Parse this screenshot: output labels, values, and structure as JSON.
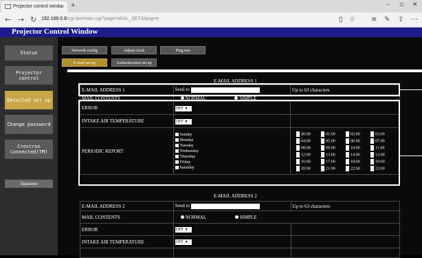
{
  "browser": {
    "tab_title": "Projector control windo",
    "tab_close": "×",
    "new_tab": "+",
    "url_host": "192.168.0.8",
    "url_path": "/cgi-bin/main.cgi?page=MAIL_SET&lang=e",
    "back": "←",
    "forward": "→",
    "refresh": "↻",
    "min": "–",
    "max": "▫",
    "close": "✕"
  },
  "page": {
    "title": "Projector Control Window"
  },
  "sidebar": {
    "items": [
      {
        "label": "Status"
      },
      {
        "label": "Projector control"
      },
      {
        "label": "Detailed set up"
      },
      {
        "label": "Change password"
      },
      {
        "label": "Crestron Connected(TM)"
      }
    ],
    "language": "Japanese"
  },
  "tabs": [
    {
      "label": "Network config"
    },
    {
      "label": "Adjust clock"
    },
    {
      "label": "Ping test"
    },
    {
      "label": "E-mail set up"
    },
    {
      "label": "Authentication set up"
    }
  ],
  "email1": {
    "header": "E-MAIL ADDRESS 1",
    "address_label": "E-MAIL ADDRESS 1",
    "send_to": "Send to",
    "limit": "Up to 63 characters",
    "mail_contents_label": "MAIL CONTENTS",
    "normal": "NORMAL",
    "simple": "SIMPLE",
    "error_label": "ERROR",
    "error_value": "OFF",
    "intake_label": "INTAKE AIR TEMPERATURE",
    "intake_value": "OFF",
    "periodic_label": "PERIODIC REPORT",
    "days": [
      "Sunday",
      "Monday",
      "Tuesday",
      "Wednesday",
      "Thursday",
      "Friday",
      "Saturday"
    ],
    "hours": [
      "00:00",
      "01:00",
      "02:00",
      "03:00",
      "04:00",
      "05:00",
      "06:00",
      "07:00",
      "08:00",
      "09:00",
      "10:00",
      "11:00",
      "12:00",
      "13:00",
      "14:00",
      "15:00",
      "16:00",
      "17:00",
      "18:00",
      "19:00",
      "20:00",
      "21:00",
      "22:00",
      "23:00"
    ]
  },
  "email2": {
    "header": "E-MAIL ADDRESS 2",
    "address_label": "E-MAIL ADDRESS 2",
    "send_to": "Send to",
    "limit": "Up to 63 characters",
    "mail_contents_label": "MAIL CONTENTS",
    "normal": "NORMAL",
    "simple": "SIMPLE",
    "error_label": "ERROR",
    "error_value": "OFF",
    "intake_label": "INTAKE AIR TEMPERATURE",
    "intake_value": "OFF"
  }
}
